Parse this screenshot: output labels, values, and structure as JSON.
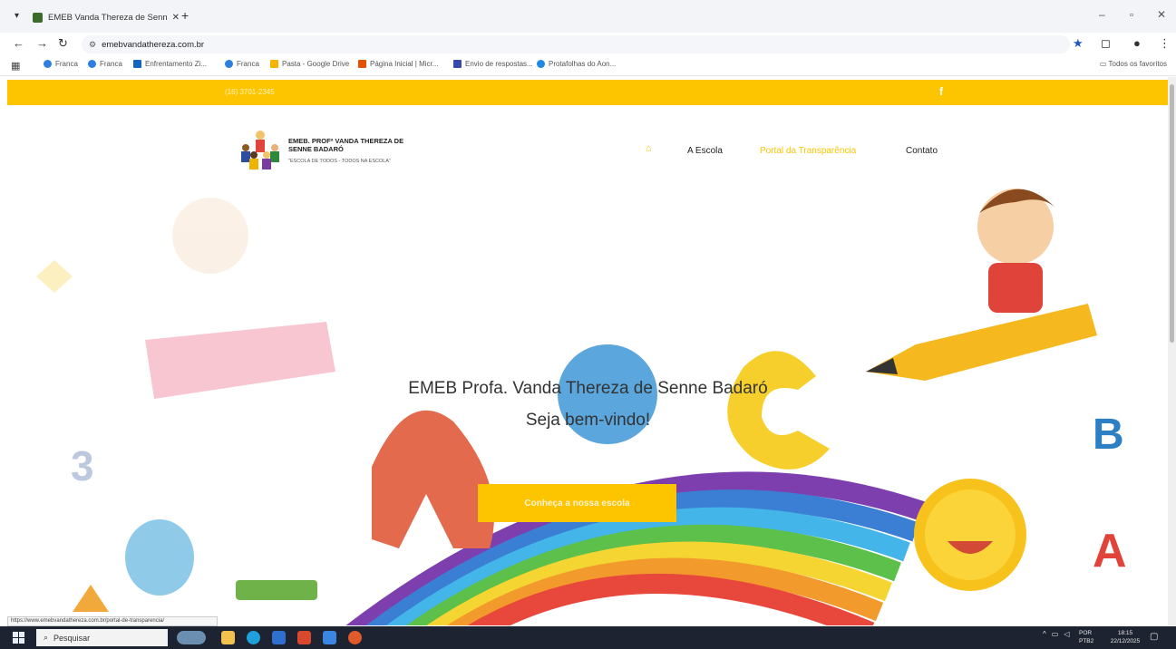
{
  "browser": {
    "tab_title": "EMEB Vanda Thereza de Senn",
    "url": "emebvandathereza.com.br",
    "bookmarks": [
      {
        "label": "Franca",
        "color": "#2f7fe0"
      },
      {
        "label": "Franca",
        "color": "#2f7fe0"
      },
      {
        "label": "Enfrentamento Zi...",
        "color": "#1565c0"
      },
      {
        "label": "Franca",
        "color": "#2f7fe0"
      },
      {
        "label": "Pasta - Google Drive",
        "color": "#f4b400"
      },
      {
        "label": "Página Inicial | Micr...",
        "color": "#e65100"
      },
      {
        "label": "Envio de respostas...",
        "color": "#3949ab"
      },
      {
        "label": "Protafolhas do Aon...",
        "color": "#1e88e5"
      }
    ],
    "all_bookmarks": "Todos os favoritos",
    "status_url": "https://www.emebvandathereza.com.br/portal-de-transparencia/"
  },
  "site": {
    "topbar": {
      "phone": "(16) 3701-2345",
      "facebook_glyph": "f"
    },
    "logo": {
      "name": "EMEB. PROFª VANDA THEREZA DE SENNE BADARÓ",
      "motto": "\"ESCOLA DE TODOS - TODOS NA ESCOLA\""
    },
    "menu": {
      "home_glyph": "⌂",
      "escola": "A Escola",
      "portal": "Portal da Transparência",
      "contato": "Contato"
    },
    "hero": {
      "title": "EMEB Profa. Vanda Thereza de Senne Badaró",
      "subtitle": "Seja bem-vindo!",
      "button": "Conheça a nossa escola"
    }
  },
  "taskbar": {
    "search_placeholder": "Pesquisar",
    "lang_line1": "POR",
    "lang_line2": "PTB2",
    "time": "18:15",
    "date": "22/12/2025"
  },
  "colors": {
    "brand_yellow": "#fdc400",
    "taskbar": "#1e2331"
  }
}
